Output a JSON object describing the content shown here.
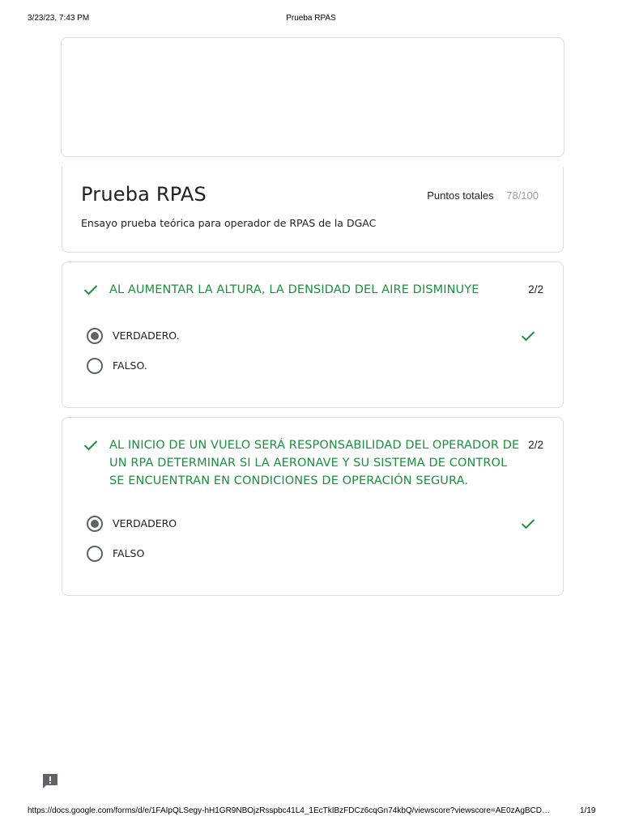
{
  "print_header": {
    "datetime": "3/23/23, 7:43 PM",
    "page_title": "Prueba RPAS"
  },
  "form": {
    "title": "Prueba RPAS",
    "description": "Ensayo prueba teórica para operador de RPAS de la DGAC",
    "score_label": "Puntos totales",
    "score_value": "78/100"
  },
  "questions": [
    {
      "text": "AL AUMENTAR LA ALTURA, LA DENSIDAD DEL AIRE DISMINUYE",
      "points": "2/2",
      "options": [
        {
          "label": "VERDADERO.",
          "selected": true,
          "correct": true
        },
        {
          "label": "FALSO.",
          "selected": false,
          "correct": false
        }
      ]
    },
    {
      "text": "AL INICIO DE UN VUELO SERÁ RESPONSABILIDAD DEL OPERADOR DE UN RPA DETERMINAR SI LA AERONAVE Y SU SISTEMA DE CONTROL SE ENCUENTRAN EN CONDICIONES DE OPERACIÓN SEGURA.",
      "points": "2/2",
      "options": [
        {
          "label": "VERDADERO",
          "selected": true,
          "correct": true
        },
        {
          "label": "FALSO",
          "selected": false,
          "correct": false
        }
      ]
    }
  ],
  "footer": {
    "url": "https://docs.google.com/forms/d/e/1FAIpQLSegy-hH1GR9NBOjzRsspbc41L4_1EcTkIBzFDCz6cqGn74kbQ/viewscore?viewscore=AE0zAgBCD…",
    "page_indicator": "1/19"
  },
  "colors": {
    "correct_green": "#1e8e3e",
    "radio_grey": "#5f6368",
    "border": "#dadce0"
  },
  "icons": {
    "question_status": "check-icon",
    "option_status": "check-icon",
    "feedback": "report-problem-icon"
  }
}
